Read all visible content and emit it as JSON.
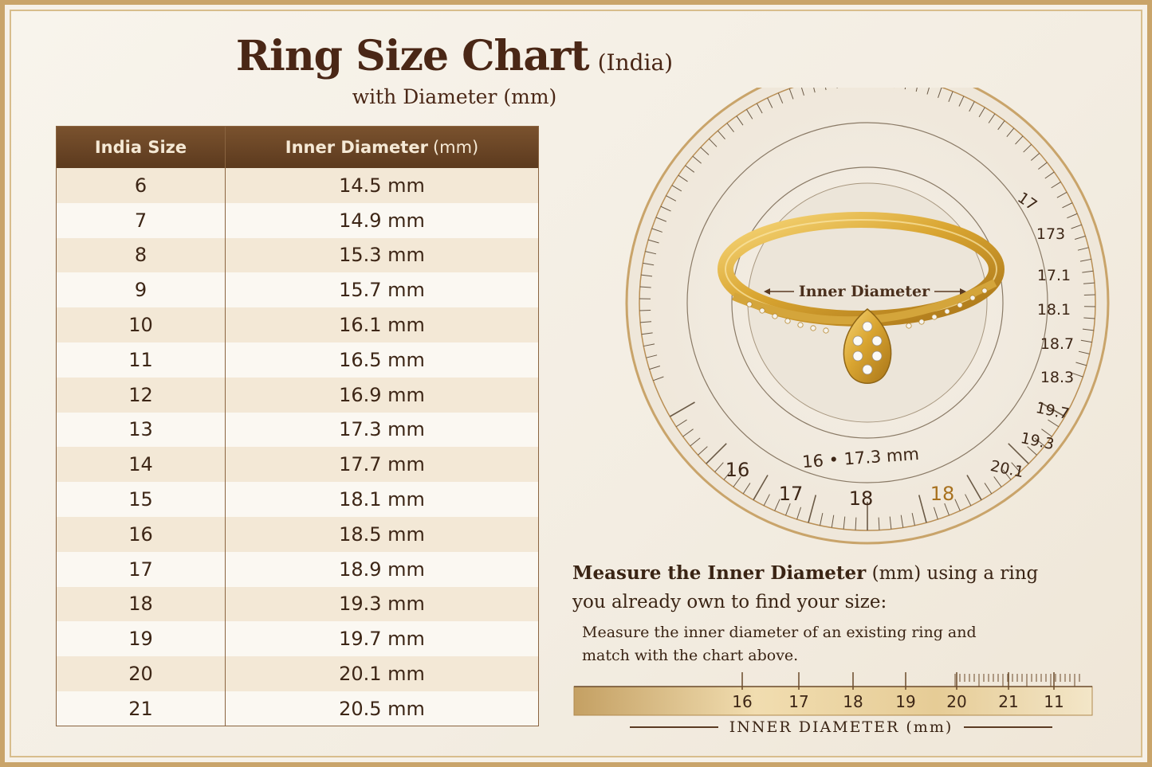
{
  "header": {
    "title": "Ring Size Chart",
    "region": "(India)",
    "subtitle": "with Diameter (mm)"
  },
  "table": {
    "col_size": "India Size",
    "col_diameter": "Inner Diameter",
    "col_diameter_unit": "(mm)",
    "rows": [
      {
        "size": "6",
        "diameter": "14.5 mm"
      },
      {
        "size": "7",
        "diameter": "14.9 mm"
      },
      {
        "size": "8",
        "diameter": "15.3 mm"
      },
      {
        "size": "9",
        "diameter": "15.7 mm"
      },
      {
        "size": "10",
        "diameter": "16.1 mm"
      },
      {
        "size": "11",
        "diameter": "16.5 mm"
      },
      {
        "size": "12",
        "diameter": "16.9 mm"
      },
      {
        "size": "13",
        "diameter": "17.3 mm"
      },
      {
        "size": "14",
        "diameter": "17.7 mm"
      },
      {
        "size": "15",
        "diameter": "18.1 mm"
      },
      {
        "size": "16",
        "diameter": "18.5 mm"
      },
      {
        "size": "17",
        "diameter": "18.9 mm"
      },
      {
        "size": "18",
        "diameter": "19.3 mm"
      },
      {
        "size": "19",
        "diameter": "19.7 mm"
      },
      {
        "size": "20",
        "diameter": "20.1 mm"
      },
      {
        "size": "21",
        "diameter": "20.5 mm"
      }
    ]
  },
  "dial": {
    "ring_label": "Inner Diameter",
    "center_reading": "16 • 17.3 mm",
    "side_labels": [
      "17",
      "173",
      "17.1",
      "18.1",
      "18.7",
      "18.3",
      "19.7",
      "19.3",
      "20.1"
    ],
    "bottom_labels": [
      "16",
      "17",
      "18",
      "18"
    ]
  },
  "instructions": {
    "head_bold": "Measure the Inner Diameter",
    "head_rest": " (mm) using a ring you already own to find your size:",
    "sub": "Measure the inner diameter of an existing ring and match with the chart above."
  },
  "ruler": {
    "ticks": [
      "16",
      "17",
      "18",
      "19",
      "20",
      "21",
      "11"
    ],
    "label": "INNER DIAMETER (mm)"
  },
  "colors": {
    "header_brown": "#5c3a1e",
    "gold": "#c9a46a",
    "row_alt": "#f3e8d6"
  }
}
